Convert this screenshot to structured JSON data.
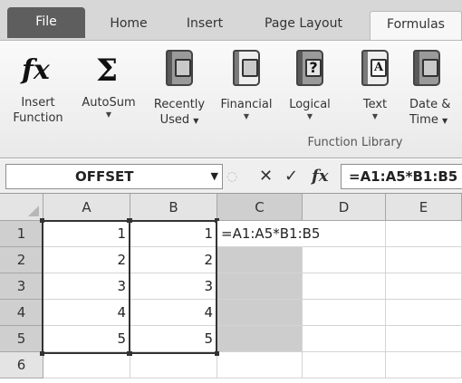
{
  "tabs": {
    "file": "File",
    "home": "Home",
    "insert": "Insert",
    "page_layout": "Page Layout",
    "formulas": "Formulas"
  },
  "ribbon": {
    "insert_function": {
      "icon": "fx-icon",
      "line1": "Insert",
      "line2": "Function"
    },
    "autosum": {
      "icon": "sigma-icon",
      "line1": "AutoSum"
    },
    "recently_used": {
      "icon": "book-star-icon",
      "line1": "Recently",
      "line2": "Used"
    },
    "financial": {
      "icon": "book-money-icon",
      "line1": "Financial"
    },
    "logical": {
      "icon": "book-question-icon",
      "line1": "Logical"
    },
    "text": {
      "icon": "book-text-icon",
      "line1": "Text"
    },
    "date_time": {
      "icon": "book-calendar-icon",
      "line1": "Date &",
      "line2": "Time"
    },
    "group_label": "Function Library"
  },
  "formula_bar": {
    "name_box": "OFFSET",
    "cancel_symbol": "✕",
    "enter_symbol": "✓",
    "fx_symbol": "fx",
    "formula": "=A1:A5*B1:B5"
  },
  "grid": {
    "columns": [
      "A",
      "B",
      "C",
      "D",
      "E"
    ],
    "rows": [
      "1",
      "2",
      "3",
      "4",
      "5",
      "6"
    ],
    "col_a": [
      "1",
      "2",
      "3",
      "4",
      "5"
    ],
    "col_b": [
      "1",
      "2",
      "3",
      "4",
      "5"
    ],
    "c1_edit_part1": "=A1:A5*",
    "c1_edit_part2": "B1:B5"
  },
  "colors": {
    "selection_shade": "#cdcdcd",
    "range_border": "#333333",
    "file_tab": "#5e5e5e"
  }
}
